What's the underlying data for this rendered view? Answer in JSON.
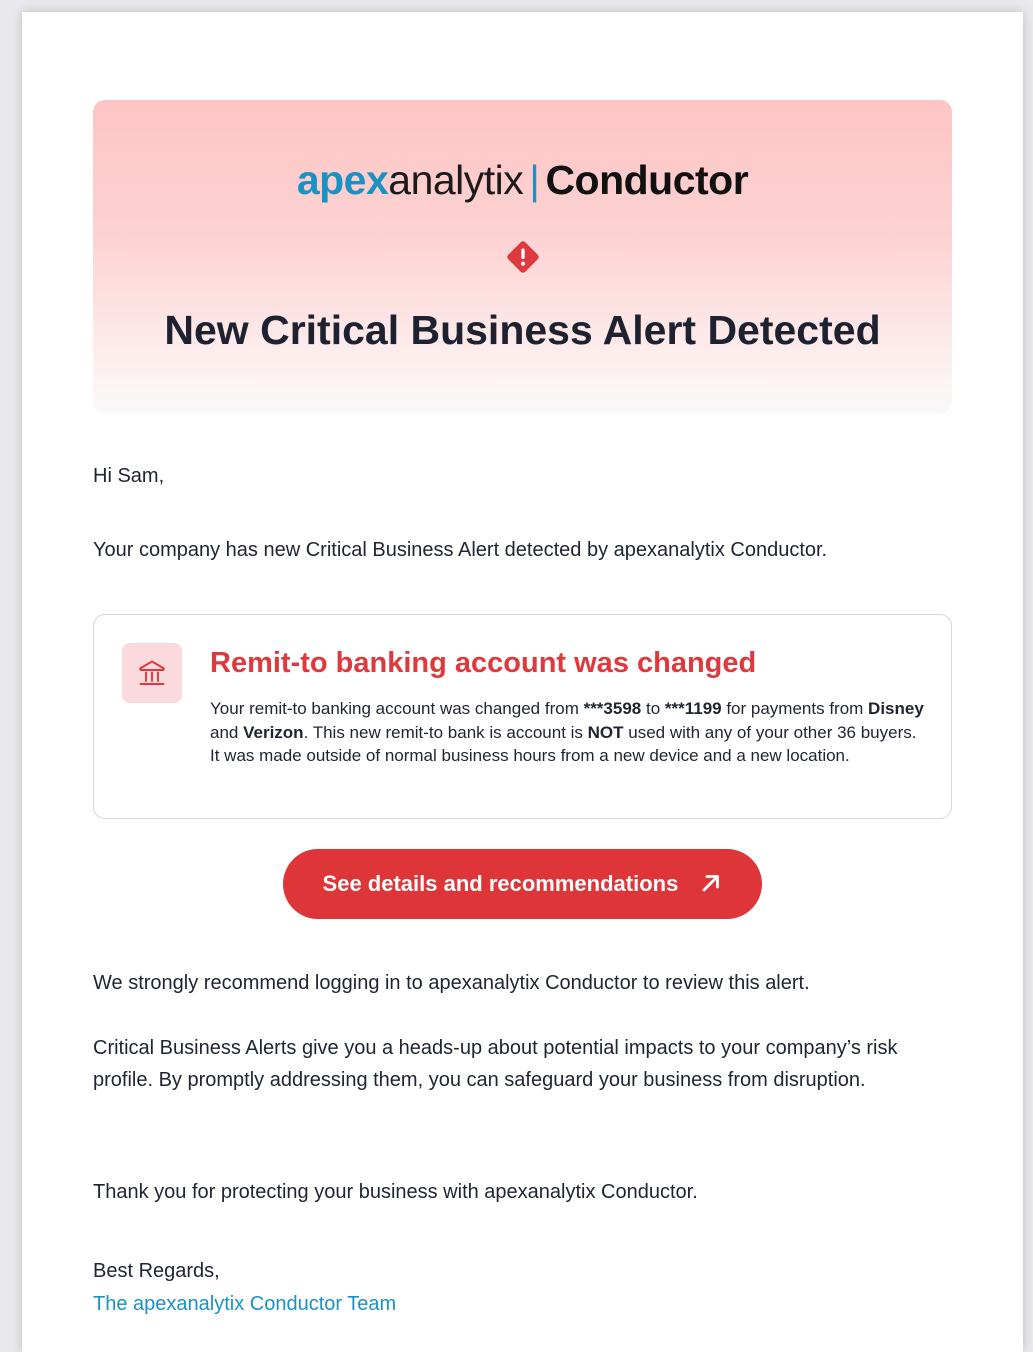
{
  "header": {
    "logo_apex": "apex",
    "logo_analytix": "analytix",
    "logo_divider": "|",
    "logo_product": "Conductor",
    "title": "New Critical Business Alert Detected",
    "alert_icon": "diamond-exclamation-icon",
    "accent_color": "#de393c",
    "brand_color": "#1a92c4"
  },
  "greeting": "Hi Sam,",
  "intro": "Your company has new Critical Business Alert detected by apexanalytix Conductor.",
  "alert": {
    "icon": "bank-icon",
    "title": "Remit-to banking account was changed",
    "desc_1": "Your remit-to banking account was changed from ",
    "old_account": "***3598",
    "desc_2": " to ",
    "new_account": "***1199",
    "desc_3": " for payments from ",
    "buyer_1": "Disney",
    "desc_4": " and ",
    "buyer_2": "Verizon",
    "desc_5": ". This new remit-to bank is account is ",
    "emphasis": "NOT",
    "desc_6": " used with any of your other 36 buyers.  It was made outside of normal business hours from a new device and a new location."
  },
  "cta": {
    "label": "See details and recommendations",
    "icon": "arrow-up-right-icon"
  },
  "recommendation": "We strongly recommend logging in to apexanalytix Conductor to review this alert.",
  "explanation": "Critical Business Alerts give you a heads-up about potential impacts to your company’s risk profile. By promptly addressing them, you can safeguard your business from disruption.",
  "thanks": "Thank you for protecting your business with apexanalytix Conductor.",
  "signoff": "Best Regards,",
  "team": "The apexanalytix Conductor Team"
}
